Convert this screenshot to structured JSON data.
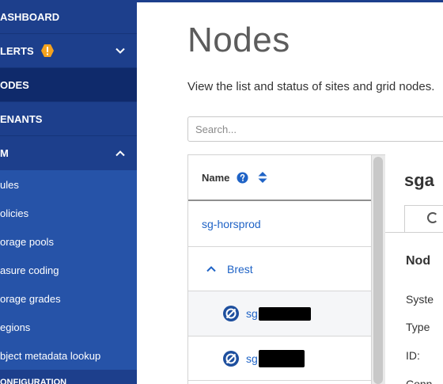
{
  "sidebar": {
    "items": [
      {
        "label": "ASHBOARD"
      },
      {
        "label": "LERTS"
      },
      {
        "label": "ODES"
      },
      {
        "label": "ENANTS"
      },
      {
        "label": "M"
      }
    ],
    "subitems": [
      {
        "label": "ules"
      },
      {
        "label": "olicies"
      },
      {
        "label": "orage pools"
      },
      {
        "label": "asure coding"
      },
      {
        "label": "orage grades"
      },
      {
        "label": "egions"
      },
      {
        "label": "bject metadata lookup"
      }
    ],
    "bottom_label": "ONFIGURATION"
  },
  "page": {
    "title": "Nodes",
    "description": "View the list and status of sites and grid nodes."
  },
  "search": {
    "placeholder": "Search..."
  },
  "tree": {
    "header": "Name",
    "rows": [
      {
        "label": "sg-horsprod"
      },
      {
        "label": "Brest"
      },
      {
        "label": "sg"
      },
      {
        "label": "sg"
      }
    ]
  },
  "detail": {
    "title": "sga",
    "section": "Nod",
    "fields": [
      "Syste",
      "Type",
      "ID:",
      "Conn"
    ]
  },
  "colors": {
    "sidebar": "#1d3f8c",
    "sidebar_active": "#0f2a6b",
    "submenu": "#2653a8",
    "link": "#1f63c6",
    "warning": "#f4a21e"
  },
  "icons": [
    "warning-icon",
    "chevron-down-icon",
    "chevron-up-icon",
    "help-icon",
    "sort-icon",
    "node-status-icon"
  ]
}
